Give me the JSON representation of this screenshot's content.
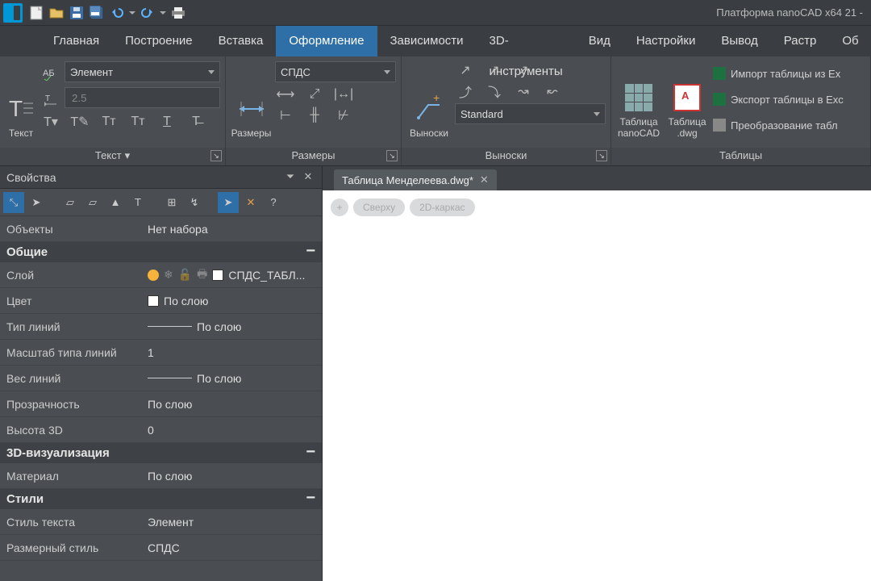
{
  "app_title": "Платформа nanoCAD x64 21 -",
  "qat": [
    "new",
    "open",
    "save",
    "saveall",
    "undo",
    "undo-dd",
    "redo",
    "redo-dd",
    "print"
  ],
  "tabs": [
    "Главная",
    "Построение",
    "Вставка",
    "Оформление",
    "Зависимости",
    "3D-инструменты",
    "Вид",
    "Настройки",
    "Вывод",
    "Растр",
    "Об"
  ],
  "active_tab": "Оформление",
  "ribbon": {
    "text": {
      "big": "Текст",
      "style_label": "Элемент",
      "height_value": "2.5",
      "group": "Текст"
    },
    "dims": {
      "big": "Размеры",
      "style_label": "СПДС",
      "group": "Размеры"
    },
    "leaders": {
      "big": "Выноски",
      "style_label": "Standard",
      "group": "Выноски"
    },
    "tables": {
      "btn1_l1": "Таблица",
      "btn1_l2": "nanoCAD",
      "btn2_l1": "Таблица",
      "btn2_l2": ".dwg",
      "link1": "Импорт таблицы из Ex",
      "link2": "Экспорт таблицы в Exc",
      "link3": "Преобразование табл",
      "group": "Таблицы"
    }
  },
  "props": {
    "title": "Свойства",
    "objects_k": "Объекты",
    "objects_v": "Нет набора",
    "sec_general": "Общие",
    "layer_k": "Слой",
    "layer_v": "СПДС_ТАБЛ...",
    "color_k": "Цвет",
    "color_v": "По слою",
    "ltype_k": "Тип линий",
    "ltype_v": "По слою",
    "ltscale_k": "Масштаб типа линий",
    "ltscale_v": "1",
    "lweight_k": "Вес линий",
    "lweight_v": "По слою",
    "transp_k": "Прозрачность",
    "transp_v": "По слою",
    "h3d_k": "Высота 3D",
    "h3d_v": "0",
    "sec_3d": "3D-визуализация",
    "mat_k": "Материал",
    "mat_v": "По слою",
    "sec_styles": "Стили",
    "tstyle_k": "Стиль текста",
    "tstyle_v": "Элемент",
    "dstyle_k": "Размерный стиль",
    "dstyle_v": "СПДС"
  },
  "doc_tab": "Таблица Менделеева.dwg*",
  "pills": [
    "+",
    "Сверху",
    "2D-каркас"
  ]
}
